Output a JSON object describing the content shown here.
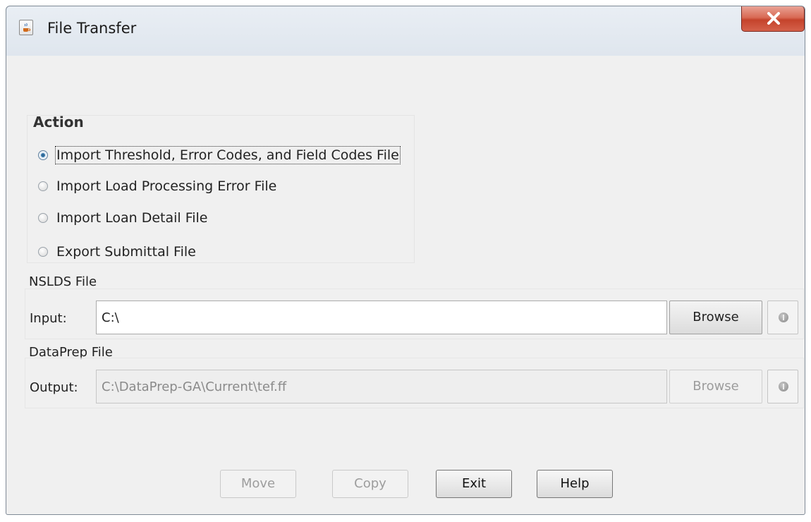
{
  "window": {
    "title": "File Transfer",
    "icon": "java-cup-icon",
    "close_glyph": "X"
  },
  "action": {
    "title": "Action",
    "options": [
      {
        "label": "Import Threshold, Error Codes, and Field Codes File",
        "checked": true
      },
      {
        "label": "Import Load Processing Error File",
        "checked": false
      },
      {
        "label": "Import Loan Detail File",
        "checked": false
      },
      {
        "label": "Export Submittal File",
        "checked": false
      }
    ]
  },
  "nslds": {
    "group_label": "NSLDS File",
    "row_label": "Input:",
    "value": "C:\\",
    "browse_label": "Browse",
    "info_icon": "info-icon"
  },
  "dataprep": {
    "group_label": "DataPrep File",
    "row_label": "Output:",
    "value": "C:\\DataPrep-GA\\Current\\tef.ff",
    "browse_label": "Browse",
    "info_icon": "info-icon"
  },
  "buttons": {
    "move": "Move",
    "copy": "Copy",
    "exit": "Exit",
    "help": "Help"
  },
  "colors": {
    "close_button": "#c5432c",
    "dialog_background": "#f0f0f0",
    "disabled_text": "#9d9d9d"
  }
}
